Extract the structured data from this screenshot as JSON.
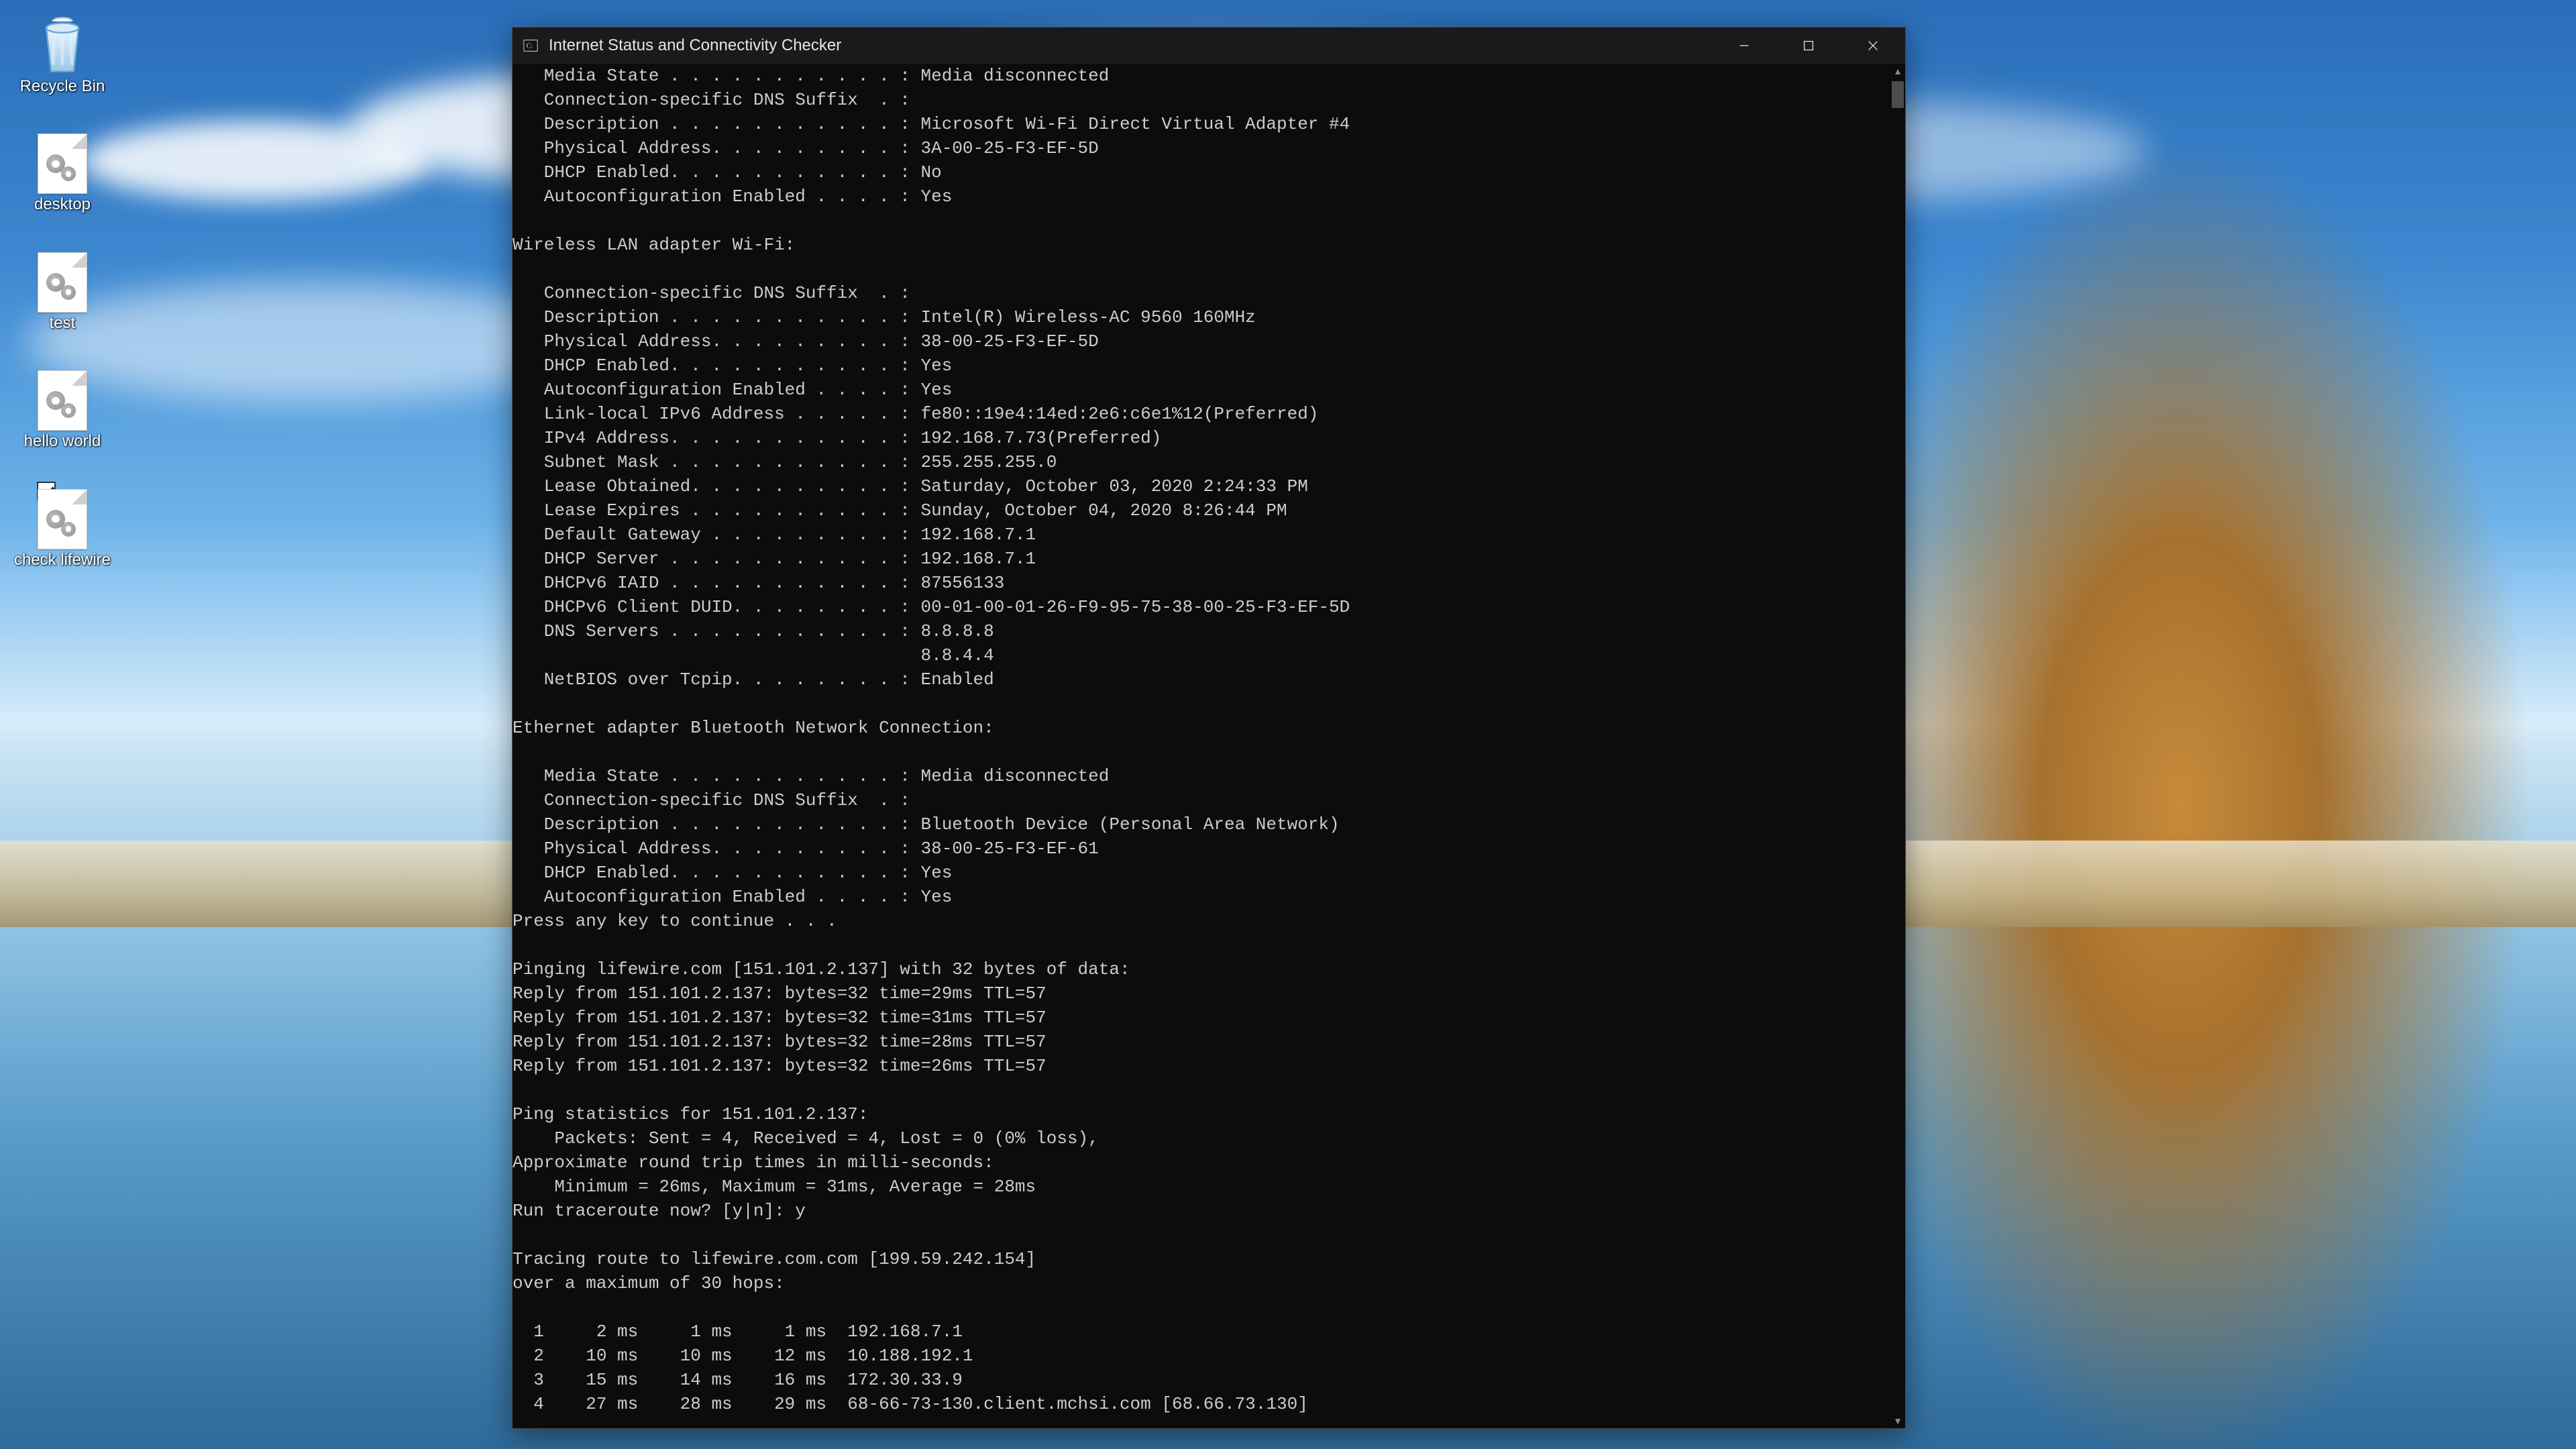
{
  "desktop_icons": [
    {
      "id": "recycle-bin",
      "label": "Recycle Bin",
      "type": "bin"
    },
    {
      "id": "desktop",
      "label": "desktop",
      "type": "batch"
    },
    {
      "id": "test",
      "label": "test",
      "type": "batch"
    },
    {
      "id": "hello-world",
      "label": "hello world",
      "type": "batch"
    },
    {
      "id": "check-lifewire",
      "label": "check lifewire",
      "type": "batch",
      "checked": true
    }
  ],
  "window": {
    "title": "Internet Status and Connectivity Checker",
    "buttons": {
      "minimize": "Minimize",
      "maximize": "Maximize",
      "close": "Close"
    }
  },
  "terminal_lines": [
    "   Media State . . . . . . . . . . . : Media disconnected",
    "   Connection-specific DNS Suffix  . :",
    "   Description . . . . . . . . . . . : Microsoft Wi-Fi Direct Virtual Adapter #4",
    "   Physical Address. . . . . . . . . : 3A-00-25-F3-EF-5D",
    "   DHCP Enabled. . . . . . . . . . . : No",
    "   Autoconfiguration Enabled . . . . : Yes",
    "",
    "Wireless LAN adapter Wi-Fi:",
    "",
    "   Connection-specific DNS Suffix  . :",
    "   Description . . . . . . . . . . . : Intel(R) Wireless-AC 9560 160MHz",
    "   Physical Address. . . . . . . . . : 38-00-25-F3-EF-5D",
    "   DHCP Enabled. . . . . . . . . . . : Yes",
    "   Autoconfiguration Enabled . . . . : Yes",
    "   Link-local IPv6 Address . . . . . : fe80::19e4:14ed:2e6:c6e1%12(Preferred)",
    "   IPv4 Address. . . . . . . . . . . : 192.168.7.73(Preferred)",
    "   Subnet Mask . . . . . . . . . . . : 255.255.255.0",
    "   Lease Obtained. . . . . . . . . . : Saturday, October 03, 2020 2:24:33 PM",
    "   Lease Expires . . . . . . . . . . : Sunday, October 04, 2020 8:26:44 PM",
    "   Default Gateway . . . . . . . . . : 192.168.7.1",
    "   DHCP Server . . . . . . . . . . . : 192.168.7.1",
    "   DHCPv6 IAID . . . . . . . . . . . : 87556133",
    "   DHCPv6 Client DUID. . . . . . . . : 00-01-00-01-26-F9-95-75-38-00-25-F3-EF-5D",
    "   DNS Servers . . . . . . . . . . . : 8.8.8.8",
    "                                       8.8.4.4",
    "   NetBIOS over Tcpip. . . . . . . . : Enabled",
    "",
    "Ethernet adapter Bluetooth Network Connection:",
    "",
    "   Media State . . . . . . . . . . . : Media disconnected",
    "   Connection-specific DNS Suffix  . :",
    "   Description . . . . . . . . . . . : Bluetooth Device (Personal Area Network)",
    "   Physical Address. . . . . . . . . : 38-00-25-F3-EF-61",
    "   DHCP Enabled. . . . . . . . . . . : Yes",
    "   Autoconfiguration Enabled . . . . : Yes",
    "Press any key to continue . . .",
    "",
    "Pinging lifewire.com [151.101.2.137] with 32 bytes of data:",
    "Reply from 151.101.2.137: bytes=32 time=29ms TTL=57",
    "Reply from 151.101.2.137: bytes=32 time=31ms TTL=57",
    "Reply from 151.101.2.137: bytes=32 time=28ms TTL=57",
    "Reply from 151.101.2.137: bytes=32 time=26ms TTL=57",
    "",
    "Ping statistics for 151.101.2.137:",
    "    Packets: Sent = 4, Received = 4, Lost = 0 (0% loss),",
    "Approximate round trip times in milli-seconds:",
    "    Minimum = 26ms, Maximum = 31ms, Average = 28ms",
    "Run traceroute now? [y|n]: y",
    "",
    "Tracing route to lifewire.com.com [199.59.242.154]",
    "over a maximum of 30 hops:",
    "",
    "  1     2 ms     1 ms     1 ms  192.168.7.1",
    "  2    10 ms    10 ms    12 ms  10.188.192.1",
    "  3    15 ms    14 ms    16 ms  172.30.33.9",
    "  4    27 ms    28 ms    29 ms  68-66-73-130.client.mchsi.com [68.66.73.130]"
  ]
}
